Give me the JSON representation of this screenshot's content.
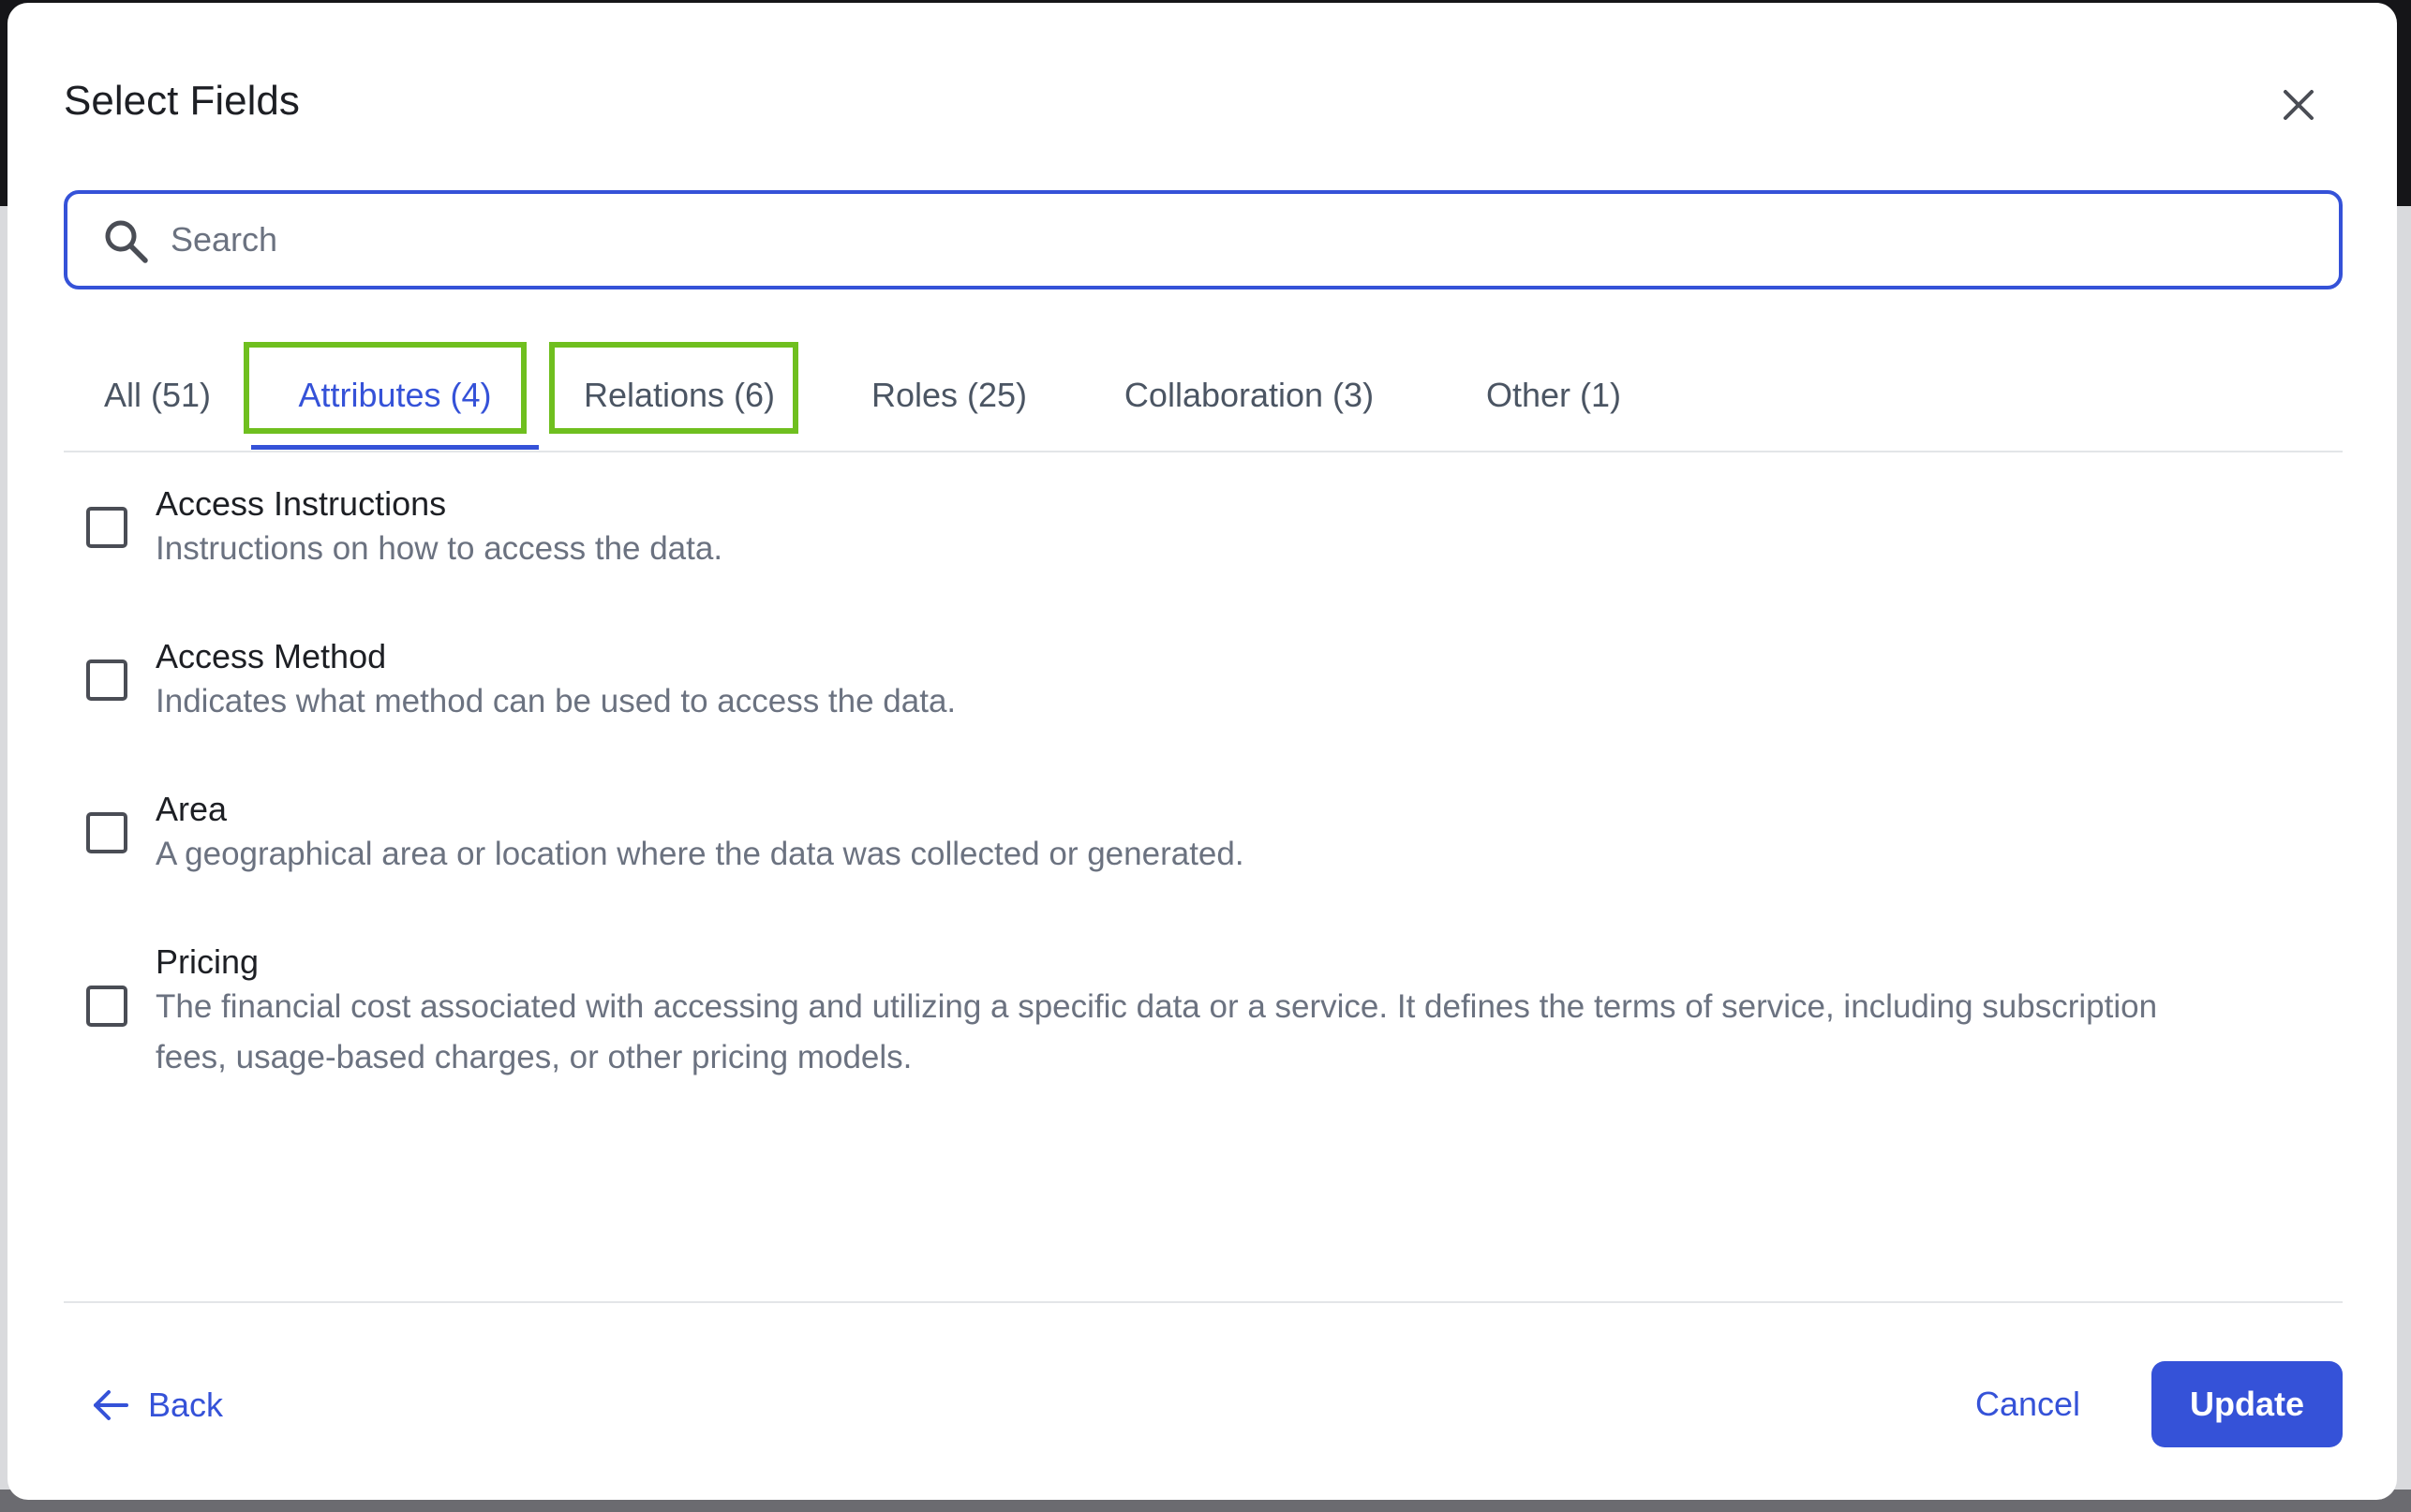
{
  "dialog": {
    "title": "Select Fields"
  },
  "search": {
    "placeholder": "Search",
    "value": ""
  },
  "tabs": [
    {
      "label": "All (51)",
      "active": false
    },
    {
      "label": "Attributes (4)",
      "active": true
    },
    {
      "label": "Relations (6)",
      "active": false
    },
    {
      "label": "Roles (25)",
      "active": false
    },
    {
      "label": "Collaboration (3)",
      "active": false
    },
    {
      "label": "Other (1)",
      "active": false
    }
  ],
  "fields": [
    {
      "name": "Access Instructions",
      "description": "Instructions on how to access the data.",
      "checked": false
    },
    {
      "name": "Access Method",
      "description": "Indicates what method can be used to access the data.",
      "checked": false
    },
    {
      "name": "Area",
      "description": "A geographical area or location where the data was collected or generated.",
      "checked": false
    },
    {
      "name": "Pricing",
      "description": "The financial cost associated with accessing and utilizing a specific data or a service. It defines the terms of service, including subscription fees, usage-based charges, or other pricing models.",
      "checked": false
    }
  ],
  "footer": {
    "back_label": "Back",
    "cancel_label": "Cancel",
    "update_label": "Update"
  },
  "colors": {
    "accent": "#3552d8",
    "highlight": "#6fbf1f",
    "text_primary": "#1d1f24",
    "text_secondary": "#6b7280"
  },
  "icons": {
    "close": "close-icon",
    "search": "search-icon",
    "back": "arrow-left-icon"
  }
}
